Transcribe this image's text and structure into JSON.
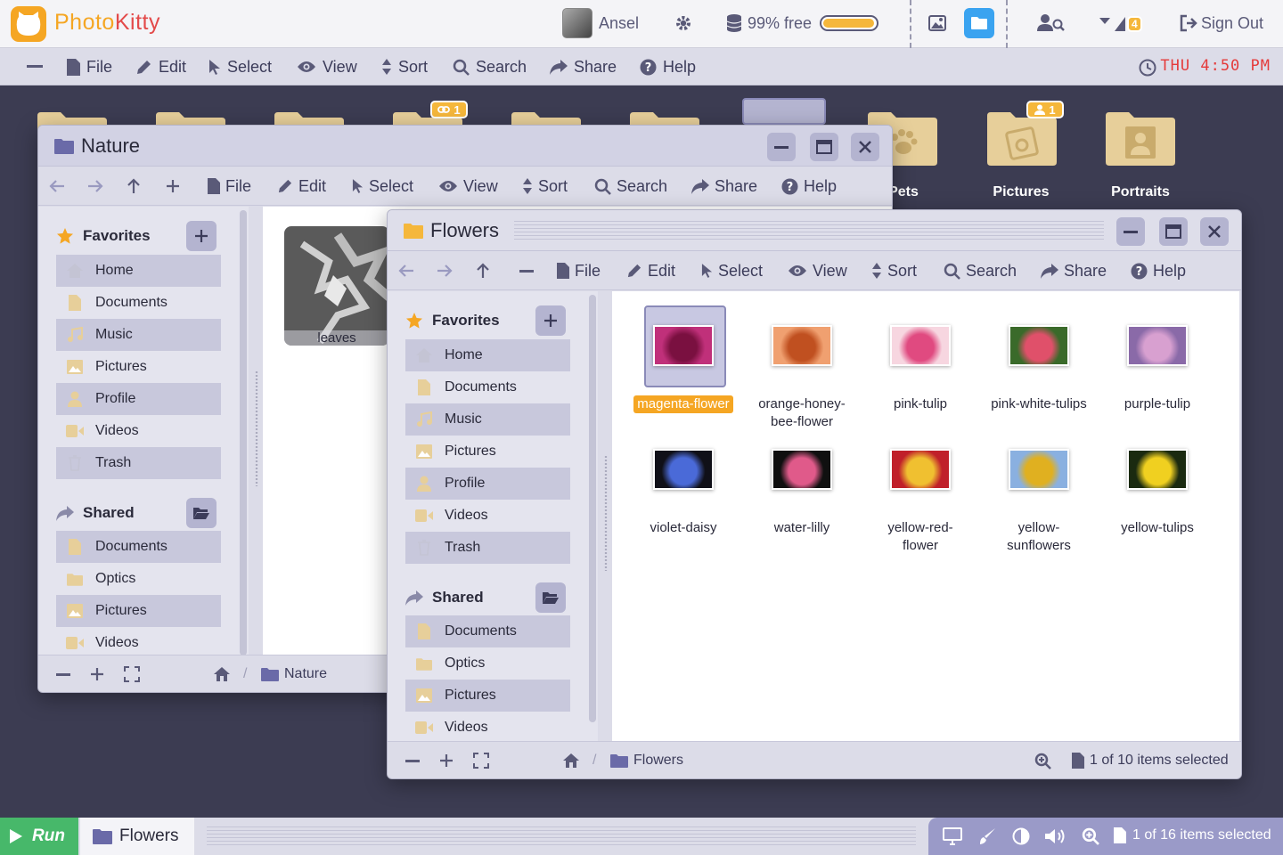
{
  "app": {
    "name_part1": "Photo",
    "name_part2": "Kitty"
  },
  "topbar": {
    "user_name": "Ansel",
    "storage_text": "99% free",
    "storage_fraction": 0.99,
    "notification_count": "4",
    "sign_out": "Sign Out"
  },
  "menubar": {
    "items": [
      "File",
      "Edit",
      "Select",
      "View",
      "Sort",
      "Search",
      "Share",
      "Help"
    ],
    "clock": "THU 4:50 PM"
  },
  "desktop": {
    "folders": [
      "Pets",
      "Pictures",
      "Portraits"
    ],
    "shared_badge_1": "1",
    "shared_badge_2": "1"
  },
  "nature_window": {
    "title": "Nature",
    "toolbar": [
      "File",
      "Edit",
      "Select",
      "View",
      "Sort",
      "Search",
      "Share",
      "Help"
    ],
    "favorites_label": "Favorites",
    "favorites": [
      "Home",
      "Documents",
      "Music",
      "Pictures",
      "Profile",
      "Videos",
      "Trash"
    ],
    "shared_label": "Shared",
    "shared": [
      "Documents",
      "Optics",
      "Pictures",
      "Videos"
    ],
    "file": "leaves",
    "breadcrumb": "Nature"
  },
  "flowers_window": {
    "title": "Flowers",
    "toolbar": [
      "File",
      "Edit",
      "Select",
      "View",
      "Sort",
      "Search",
      "Share",
      "Help"
    ],
    "favorites_label": "Favorites",
    "favorites": [
      "Home",
      "Documents",
      "Music",
      "Pictures",
      "Profile",
      "Videos",
      "Trash"
    ],
    "shared_label": "Shared",
    "shared": [
      "Documents",
      "Optics",
      "Pictures",
      "Videos"
    ],
    "files": [
      {
        "name": "magenta-flower",
        "selected": true,
        "colors": [
          "#c0307a",
          "#7a1040"
        ]
      },
      {
        "name": "orange-honey-bee-flower",
        "colors": [
          "#f0a070",
          "#c05020"
        ]
      },
      {
        "name": "pink-tulip",
        "colors": [
          "#f7d6e0",
          "#e04a80"
        ]
      },
      {
        "name": "pink-white-tulips",
        "colors": [
          "#3a6a2a",
          "#e0506a"
        ]
      },
      {
        "name": "purple-tulip",
        "colors": [
          "#8a6aa8",
          "#d8a0d0"
        ]
      },
      {
        "name": "violet-daisy",
        "colors": [
          "#101018",
          "#4a6ad8"
        ]
      },
      {
        "name": "water-lilly",
        "colors": [
          "#101010",
          "#e05a8a"
        ]
      },
      {
        "name": "yellow-red-flower",
        "colors": [
          "#c0202a",
          "#f0c030"
        ]
      },
      {
        "name": "yellow-sunflowers",
        "colors": [
          "#8ab0e0",
          "#e0b020"
        ]
      },
      {
        "name": "yellow-tulips",
        "colors": [
          "#1a2a10",
          "#f0d020"
        ]
      }
    ],
    "breadcrumb": "Flowers",
    "status": "1 of 10 items selected"
  },
  "taskbar": {
    "run_label": "Run",
    "task_label": "Flowers",
    "status": "1 of 16 items selected"
  },
  "colors": {
    "accent": "#f5a623",
    "selection": "#f5a623",
    "run": "#47b86a",
    "clock": "#e53b3b"
  }
}
